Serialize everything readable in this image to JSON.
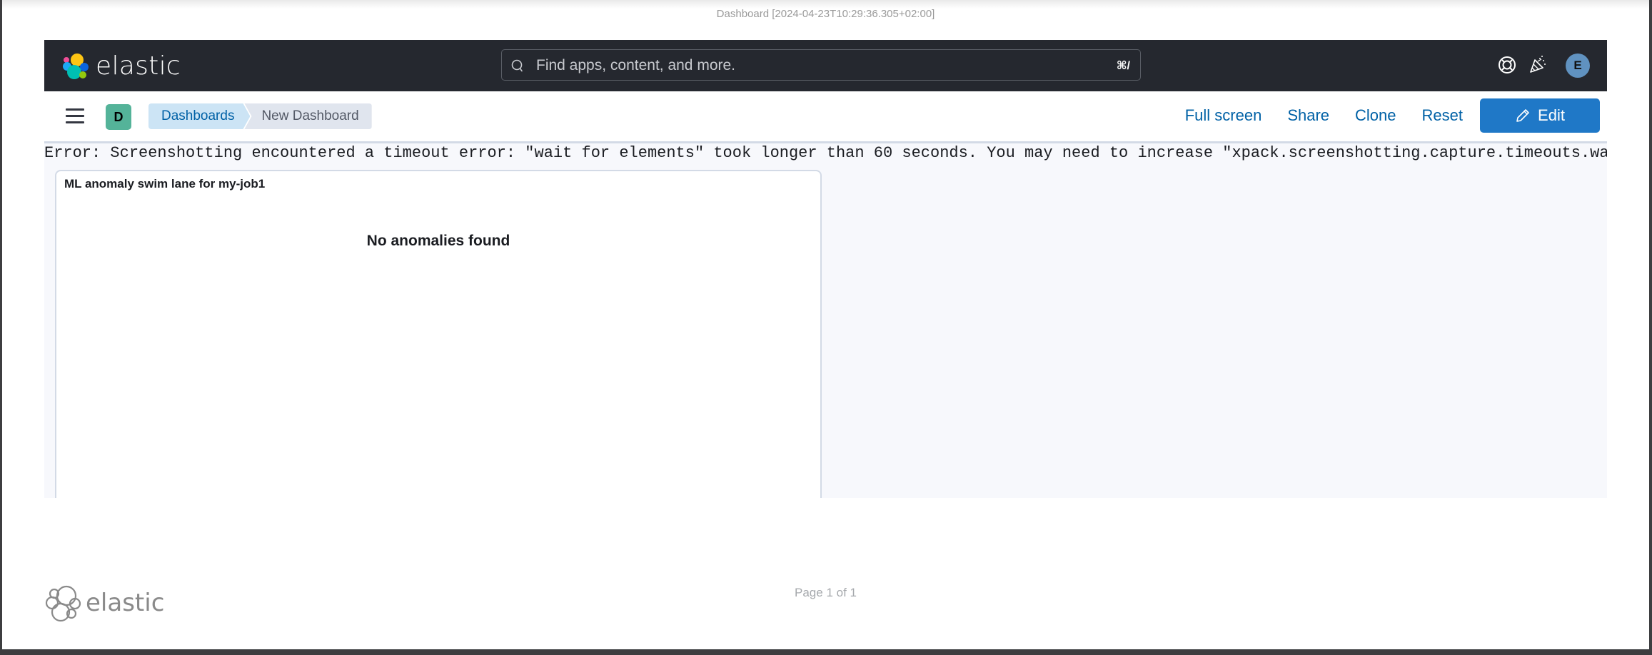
{
  "report": {
    "title": "Dashboard [2024-04-23T10:29:36.305+02:00]",
    "page_label": "Page 1 of 1"
  },
  "header": {
    "brand": "elastic",
    "search": {
      "placeholder": "Find apps, content, and more.",
      "shortcut": "⌘/"
    },
    "icons": [
      "help-lifebuoy-icon",
      "whats-new-party-icon"
    ],
    "user_avatar_initial": "E"
  },
  "subheader": {
    "space_avatar_initial": "D",
    "breadcrumbs": [
      {
        "label": "Dashboards"
      },
      {
        "label": "New Dashboard"
      }
    ],
    "actions": {
      "full_screen": "Full screen",
      "share": "Share",
      "clone": "Clone",
      "reset": "Reset",
      "edit": "Edit"
    }
  },
  "dashboard": {
    "error_message": "Error: Screenshotting encountered a timeout error: \"wait for elements\" took longer than 60 seconds. You may need to increase \"xpack.screenshotting.capture.timeouts.waitForElements\" in kibana.yml.",
    "panels": [
      {
        "title": "ML anomaly swim lane for my-job1",
        "message": "No anomalies found"
      }
    ]
  },
  "footer": {
    "brand": "elastic"
  },
  "colors": {
    "header_bg": "#25282f",
    "primary": "#1f78c7",
    "link": "#0061a6",
    "dashboard_bg": "#f7f8fc"
  }
}
